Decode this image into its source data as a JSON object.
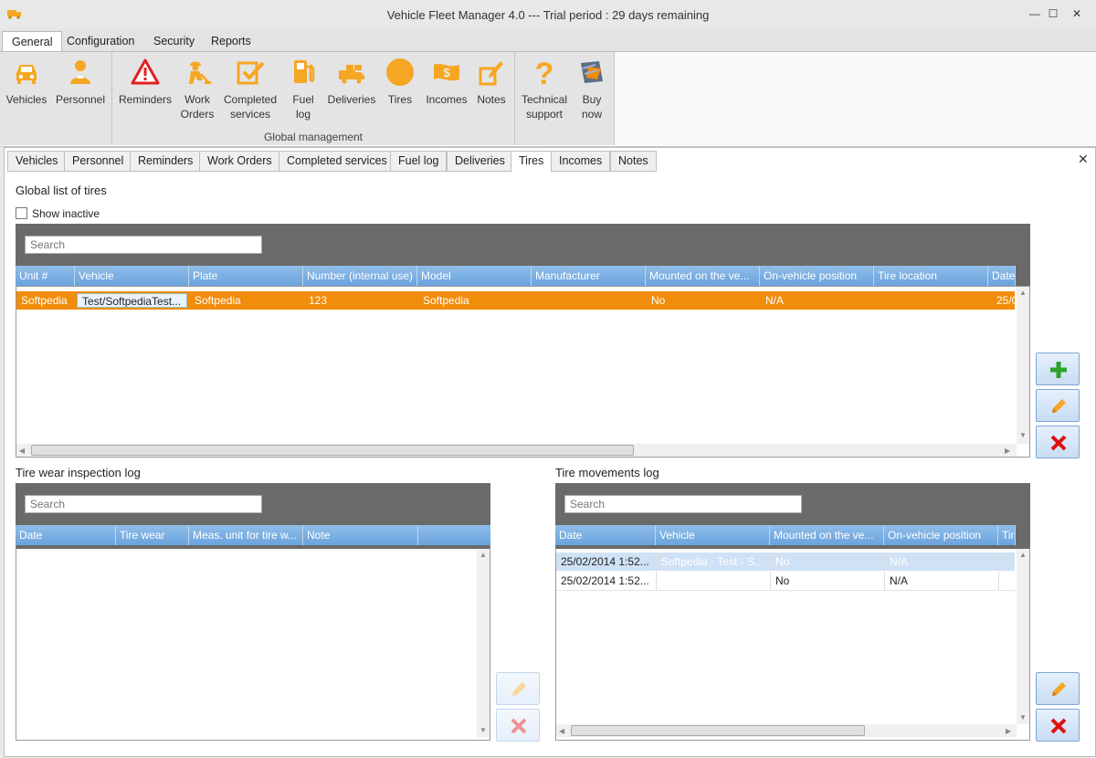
{
  "window": {
    "title": "Vehicle Fleet Manager 4.0 --- Trial period : 29 days remaining",
    "min": "—",
    "max": "☐",
    "close": "✕"
  },
  "menu": {
    "tabs": [
      "General",
      "Configuration",
      "Security",
      "Reports"
    ]
  },
  "ribbon": {
    "buttons": [
      {
        "label": "Vehicles",
        "icon": "car-icon"
      },
      {
        "label": "Personnel",
        "icon": "person-icon"
      },
      {
        "label": "Reminders",
        "icon": "warning-icon"
      },
      {
        "label": "Work\nOrders",
        "icon": "worker-icon"
      },
      {
        "label": "Completed\nservices",
        "icon": "checklist-icon"
      },
      {
        "label": "Fuel\nlog",
        "icon": "fuel-pump-icon"
      },
      {
        "label": "Deliveries",
        "icon": "truck-icon"
      },
      {
        "label": "Tires",
        "icon": "tire-icon"
      },
      {
        "label": "Incomes",
        "icon": "money-icon"
      },
      {
        "label": "Notes",
        "icon": "note-icon"
      },
      {
        "label": "Technical\nsupport",
        "icon": "question-icon"
      },
      {
        "label": "Buy\nnow",
        "icon": "buy-icon"
      }
    ],
    "group_caption": "Global management"
  },
  "content_tabs": [
    "Vehicles",
    "Personnel",
    "Reminders",
    "Work Orders",
    "Completed services",
    "Fuel log",
    "Deliveries",
    "Tires",
    "Incomes",
    "Notes"
  ],
  "tires": {
    "title": "Global list of tires",
    "show_inactive": "Show inactive",
    "search_placeholder": "Search",
    "columns": [
      "Unit #",
      "Vehicle",
      "Plate",
      "Number (internal use)",
      "Model",
      "Manufacturer",
      "Mounted on the ve...",
      "On-vehicle position",
      "Tire location",
      "Date"
    ],
    "rows": [
      [
        "Softpedia",
        "Test/SoftpediaTest...",
        "Softpedia",
        "123",
        "Softpedia",
        "",
        "No",
        "N/A",
        "",
        "25/0"
      ]
    ]
  },
  "wear_log": {
    "title": "Tire wear inspection log",
    "search_placeholder": "Search",
    "columns": [
      "Date",
      "Tire wear",
      "Meas. unit for tire w...",
      "Note"
    ]
  },
  "movements_log": {
    "title": "Tire movements log",
    "search_placeholder": "Search",
    "columns": [
      "Date",
      "Vehicle",
      "Mounted on the ve...",
      "On-vehicle position",
      "Tir"
    ],
    "rows": [
      [
        "25/02/2014 1:52...",
        "Softpedia - Test - S...",
        "No",
        "N/A",
        ""
      ],
      [
        "25/02/2014 1:52...",
        "",
        "No",
        "N/A",
        ""
      ]
    ]
  },
  "colors": {
    "selection_orange": "#f28c0b",
    "header_blue": "#79aee2",
    "accent_icon": "#f5a623"
  }
}
